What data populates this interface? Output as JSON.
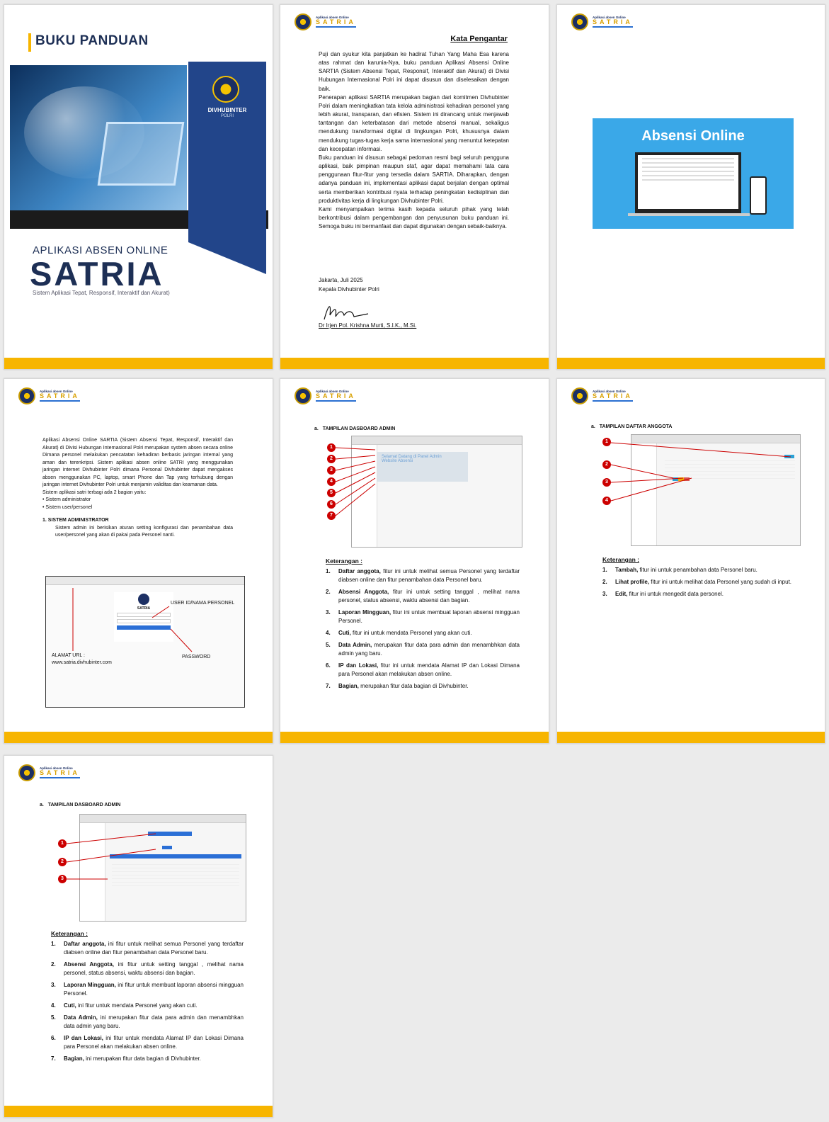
{
  "header": {
    "small": "Aplikasi absen Online",
    "big": "SATRIA"
  },
  "cover": {
    "title": "BUKU PANDUAN",
    "panel_line1": "DIVHUBINTER",
    "panel_line2": "POLRI",
    "sub1": "APLIKASI ABSEN ONLINE",
    "sub2": "SATRIA",
    "sub3": "Sistem Aplikasi Tepat, Responsif, Interaktif dan Akurat)"
  },
  "foreword": {
    "title": "Kata Pengantar",
    "p1": "Puji dan syukur kita panjatkan ke hadirat Tuhan Yang Maha Esa karena atas rahmat dan karunia-Nya, buku panduan Aplikasi Absensi Online SARTIA (Sistem Absensi Tepat, Responsif, Interaktif dan Akurat) di Divisi Hubungan Internasional Polri ini dapat disusun dan diselesaikan dengan baik.",
    "p2": "Penerapan aplikasi SARTIA merupakan bagian dari komitmen Divhubinter Polri dalam meningkatkan tata kelola administrasi kehadiran personel yang lebih akurat, transparan, dan efisien. Sistem ini dirancang untuk menjawab tantangan dan keterbatasan dari metode absensi manual, sekaligus mendukung transformasi digital di lingkungan Polri, khususnya dalam mendukung tugas-tugas kerja sama internasional yang menuntut ketepatan dan kecepatan informasi.",
    "p3": "Buku panduan ini disusun sebagai pedoman resmi bagi seluruh pengguna aplikasi, baik pimpinan maupun staf, agar dapat memahami tata cara penggunaan fitur-fitur yang tersedia dalam SARTIA. Diharapkan, dengan adanya panduan ini, implementasi aplikasi dapat berjalan dengan optimal serta memberikan kontribusi nyata terhadap peningkatan kedisiplinan dan produktivitas kerja di lingkungan Divhubinter Polri.",
    "p4": "Kami menyampaikan terima kasih kepada seluruh pihak yang telah berkontribusi dalam pengembangan dan penyusunan buku panduan ini. Semoga buku ini bermanfaat dan dapat digunakan dengan sebaik-baiknya.",
    "place": "Jakarta,  Juli 2025",
    "role": "Kepala Divhubinter Polri",
    "name": "Dr Irjen Pol. Krishna Murti, S.I.K., M.Si."
  },
  "p3": {
    "banner": "Absensi Online"
  },
  "intro": {
    "para": "Aplikasi Absensi Online SARTIA (Sistem Absensi Tepat, Responsif, Interaktif dan Akurat) di Divisi Hubungan Internasional Polri merupakan system absen secara online Dimana personel melakukan pencatatan kehadiran berbasis jaringan internal yang aman dan terenkripsi. Sistem aplikasi absen online SATRI yang menggunakan jaringan internet Divhubinter Polri dimana Personal Divhubinter dapat mengakses absen menggunakan PC, laptop, smart Phone dan Tap yang terhubung dengan jaringan internet Divhubinter Polri untuk menjamin validitas dan keamanan data.",
    "line2": "Sistem aplikasi satri terbagi ada 2 bagian yaitu:",
    "bullets": [
      "Sistem administrator",
      "Sistem user/personel"
    ],
    "section_num": "1.",
    "section_title": "SISTEM ADMINISTRATOR",
    "section_text": "Sistem admin ini berisikan aturan setting konfigurasi dan penambahan data user/personel yang akan di pakai pada Personel nanti.",
    "login_title": "SATRIA",
    "ann_user": "USER ID/NAMA PERSONEL",
    "ann_pass": "PASSWORD",
    "ann_url1": "ALAMAT URL :",
    "ann_url2": "www.satria.divhubinter.com"
  },
  "dash": {
    "section": "a.",
    "title": "TAMPILAN DASBOARD ADMIN",
    "welcome1": "Selamat Datang di Panel Admin",
    "welcome2": "Website Absensi",
    "badges": [
      "1",
      "2",
      "3",
      "4",
      "5",
      "6",
      "7"
    ],
    "ket": "Keterangan :",
    "items": [
      {
        "n": "1.",
        "b": "Daftar anggota,",
        "t": " fitur ini untuk melihat semua Personel yang terdaftar diabsen online dan fitur penambahan data Personel baru."
      },
      {
        "n": "2.",
        "b": "Absensi Anggota,",
        "t": " fitur ini untuk setting tanggal , melihat nama personel, status absensi, waktu absensi dan bagian."
      },
      {
        "n": "3.",
        "b": "Laporan Mingguan,",
        "t": " fitur ini untuk membuat laporan absensi mingguan Personel."
      },
      {
        "n": "4.",
        "b": "Cuti,",
        "t": " fitur ini untuk mendata Personel yang akan cuti."
      },
      {
        "n": "5.",
        "b": "Data Admin,",
        "t": " merupakan fitur data para admin dan menambhkan data admin yang baru."
      },
      {
        "n": "6.",
        "b": "IP dan Lokasi,",
        "t": " fitur ini untuk mendata Alamat IP dan Lokasi Dimana para Personel akan melakukan absen online."
      },
      {
        "n": "7.",
        "b": "Bagian,",
        "t": " merupakan fitur data bagian di Divhubinter."
      }
    ]
  },
  "daftar": {
    "section": "a.",
    "title": "TAMPILAN DAFTAR ANGGOTA",
    "badges": [
      "1",
      "2",
      "3",
      "4"
    ],
    "ket": "Keterangan :",
    "items": [
      {
        "n": "1.",
        "b": "Tambah,",
        "t": " fitur ini untuk penambahan data Personel baru."
      },
      {
        "n": "2.",
        "b": "Lihat profile,",
        "t": " fitur ini untuk melihat data Personel yang sudah di input."
      },
      {
        "n": "3.",
        "b": "Edit,",
        "t": " fitur ini untuk mengedit data personel."
      }
    ]
  },
  "dash2": {
    "section": "a.",
    "title": "TAMPILAN DASBOARD ADMIN",
    "badges": [
      "1",
      "2",
      "3"
    ],
    "ket": "Keterangan :",
    "items": [
      {
        "n": "1.",
        "b": "Daftar anggota,",
        "t": " ini fitur untuk melihat semua Personel yang terdaftar diabsen online dan fitur penambahan data Personel baru."
      },
      {
        "n": "2.",
        "b": "Absensi Anggota,",
        "t": " ini fitur untuk setting tanggal , melihat nama personel, status absensi, waktu absensi dan bagian."
      },
      {
        "n": "3.",
        "b": "Laporan Mingguan,",
        "t": " ini fitur untuk membuat laporan absensi mingguan Personel."
      },
      {
        "n": "4.",
        "b": "Cuti,",
        "t": " ini fitur untuk mendata Personel yang akan cuti."
      },
      {
        "n": "5.",
        "b": "Data Admin,",
        "t": " ini merupakan fitur data para admin dan menambhkan data admin yang baru."
      },
      {
        "n": "6.",
        "b": "IP dan Lokasi,",
        "t": " ini fitur untuk mendata Alamat IP dan Lokasi Dimana para Personel akan melakukan absen online."
      },
      {
        "n": "7.",
        "b": "Bagian,",
        "t": " ini merupakan fitur data bagian di Divhubinter."
      }
    ]
  }
}
